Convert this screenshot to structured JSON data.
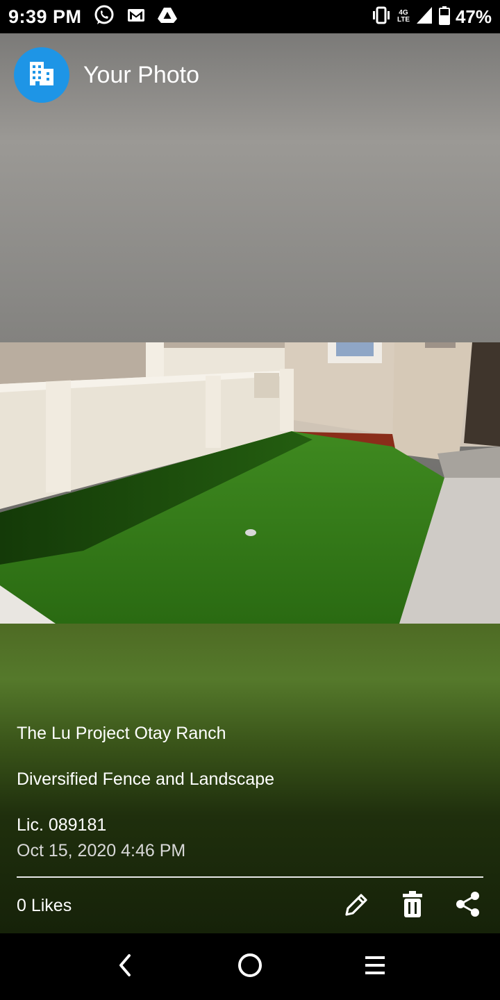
{
  "status_bar": {
    "time": "9:39 PM",
    "network": "4G LTE",
    "battery": "47%",
    "icons": [
      "whatsapp-icon",
      "gmail-icon",
      "drive-icon",
      "vibrate-icon",
      "signal-icon",
      "battery-icon"
    ]
  },
  "header": {
    "title": "Your Photo",
    "avatar_icon": "building-icon",
    "accent_color": "#1e95e6"
  },
  "caption": {
    "line1": "The Lu Project Otay Ranch",
    "line2": "Diversified Fence and Landscape",
    "line3": "Lic. 089181",
    "date": "Oct 15, 2020 4:46 PM"
  },
  "footer": {
    "likes": "0 Likes",
    "actions": [
      "edit-icon",
      "delete-icon",
      "share-icon"
    ]
  },
  "nav": {
    "buttons": [
      "back-icon",
      "home-icon",
      "menu-icon"
    ]
  }
}
